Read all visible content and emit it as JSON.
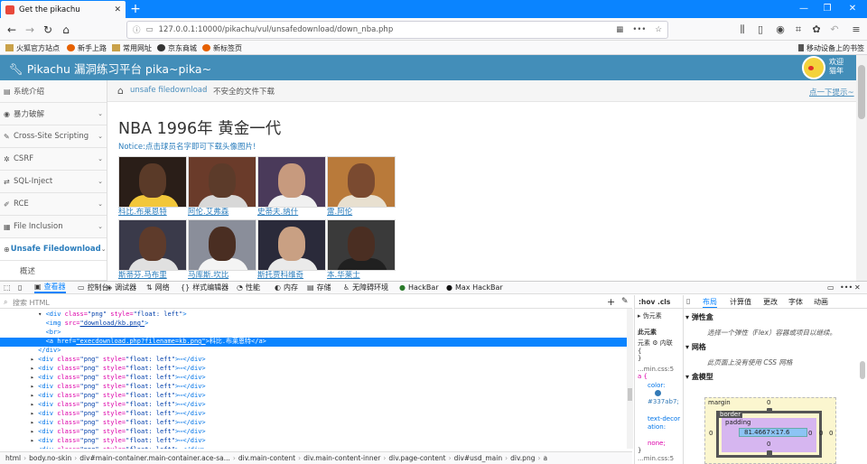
{
  "browser": {
    "tab_title": "Get the pikachu",
    "tab_close": "✕",
    "new_tab": "+",
    "url": "127.0.0.1:10000/pikachu/vul/unsafedownload/down_nba.php",
    "bookmarks": [
      "火狐官方站点",
      "新手上路",
      "常用网址",
      "京东商城",
      "新标签页"
    ],
    "mobile_bookmarks": "移动设备上的书签"
  },
  "site": {
    "title": "Pikachu 漏洞练习平台 pika~pika~",
    "welcome": [
      "欢迎",
      "猫年"
    ]
  },
  "sidebar": {
    "items": [
      {
        "icon": "▤",
        "label": "系统介绍",
        "chev": ""
      },
      {
        "icon": "◉",
        "label": "暴力破解",
        "chev": "⌄"
      },
      {
        "icon": "✎",
        "label": "Cross-Site Scripting",
        "chev": "⌄"
      },
      {
        "icon": "✲",
        "label": "CSRF",
        "chev": "⌄"
      },
      {
        "icon": "⇄",
        "label": "SQL-Inject",
        "chev": "⌄"
      },
      {
        "icon": "✐",
        "label": "RCE",
        "chev": "⌄"
      },
      {
        "icon": "▦",
        "label": "File Inclusion",
        "chev": "⌄"
      },
      {
        "icon": "⊕",
        "label": "Unsafe Filedownload",
        "chev": "⌄"
      },
      {
        "icon": "",
        "label": "概述",
        "chev": ""
      }
    ]
  },
  "breadcrumb": {
    "link": "unsafe filedownload",
    "separator": "›",
    "current": "不安全的文件下载",
    "hint": "点一下提示~"
  },
  "content": {
    "title": "NBA 1996年 黄金一代",
    "notice": "Notice:点击球员名字即可下载头像图片!",
    "players": [
      {
        "name": "科比.布莱恩特",
        "skin": "#5a3a28",
        "shirt": "#f2c73a",
        "bg": "#2a1e18"
      },
      {
        "name": "阿伦.艾弗森",
        "skin": "#5c3b2a",
        "shirt": "#d8d8d8",
        "bg": "#6a3b2a"
      },
      {
        "name": "史蒂夫.纳什",
        "skin": "#c79a7e",
        "shirt": "#f0f0f0",
        "bg": "#4a3a5a"
      },
      {
        "name": "雷.阿伦",
        "skin": "#7a4a30",
        "shirt": "#e8e0d0",
        "bg": "#b97a3a"
      },
      {
        "name": "斯蒂芬.马布里",
        "skin": "#5e3b2b",
        "shirt": "#e0e0e0",
        "bg": "#3a3a4a"
      },
      {
        "name": "马库斯.坎比",
        "skin": "#4a2e22",
        "shirt": "#f4f4f4",
        "bg": "#8a8e9a"
      },
      {
        "name": "斯托贾科维奇",
        "skin": "#c9a083",
        "shirt": "#eaeaea",
        "bg": "#2a2a3a"
      },
      {
        "name": "本.华莱士",
        "skin": "#4a2e22",
        "shirt": "#202020",
        "bg": "#3a3a3a"
      }
    ]
  },
  "devtools": {
    "tabs": [
      {
        "icon": "▣",
        "label": "查看器"
      },
      {
        "icon": "▭",
        "label": "控制台"
      },
      {
        "icon": "◈",
        "label": "调试器"
      },
      {
        "icon": "⇅",
        "label": "网络"
      },
      {
        "icon": "{}",
        "label": "样式编辑器"
      },
      {
        "icon": "◔",
        "label": "性能"
      },
      {
        "icon": "◐",
        "label": "内存"
      },
      {
        "icon": "▤",
        "label": "存储"
      },
      {
        "icon": "♿",
        "label": "无障碍环境"
      },
      {
        "icon": "●",
        "label": "HackBar"
      },
      {
        "icon": "●",
        "label": "Max HackBar"
      }
    ],
    "search_placeholder": "搜索 HTML",
    "markup_lines": [
      {
        "indent": "          ",
        "arrow": "▾ ",
        "open": "<div",
        "a1": " class=",
        "v1": "\"png\"",
        "a2": " style=",
        "v2": "\"float: left\"",
        "close": ">",
        "tail": ""
      },
      {
        "indent": "            ",
        "arrow": "",
        "open": "<img",
        "a1": " src=",
        "v1": "\"download/kb.png\"",
        "a2": "",
        "v2": "",
        "close": ">",
        "tail": ""
      },
      {
        "indent": "            ",
        "arrow": "",
        "open": "<br>",
        "a1": "",
        "v1": "",
        "a2": "",
        "v2": "",
        "close": "",
        "tail": ""
      },
      {
        "indent": "            ",
        "arrow": "",
        "open": "<a",
        "a1": " href=",
        "v1": "\"execdownload.php?filename=kb.png\"",
        "a2": "",
        "v2": "",
        "close": ">",
        "tail": "科比.布莱恩特</a>"
      },
      {
        "indent": "          ",
        "arrow": "",
        "open": "</div>",
        "a1": "",
        "v1": "",
        "a2": "",
        "v2": "",
        "close": "",
        "tail": ""
      },
      {
        "indent": "        ",
        "arrow": "▸ ",
        "open": "<div",
        "a1": " class=",
        "v1": "\"png\"",
        "a2": " style=",
        "v2": "\"float: left\"",
        "close": ">",
        "tail": "⋯</div>"
      },
      {
        "indent": "        ",
        "arrow": "▸ ",
        "open": "<div",
        "a1": " class=",
        "v1": "\"png\"",
        "a2": " style=",
        "v2": "\"float: left\"",
        "close": ">",
        "tail": "⋯</div>"
      },
      {
        "indent": "        ",
        "arrow": "▸ ",
        "open": "<div",
        "a1": " class=",
        "v1": "\"png\"",
        "a2": " style=",
        "v2": "\"float: left\"",
        "close": ">",
        "tail": "⋯</div>"
      },
      {
        "indent": "        ",
        "arrow": "▸ ",
        "open": "<div",
        "a1": " class=",
        "v1": "\"png\"",
        "a2": " style=",
        "v2": "\"float: left\"",
        "close": ">",
        "tail": "⋯</div>"
      },
      {
        "indent": "        ",
        "arrow": "▸ ",
        "open": "<div",
        "a1": " class=",
        "v1": "\"png\"",
        "a2": " style=",
        "v2": "\"float: left\"",
        "close": ">",
        "tail": "⋯</div>"
      },
      {
        "indent": "        ",
        "arrow": "▸ ",
        "open": "<div",
        "a1": " class=",
        "v1": "\"png\"",
        "a2": " style=",
        "v2": "\"float: left\"",
        "close": ">",
        "tail": "⋯</div>"
      },
      {
        "indent": "        ",
        "arrow": "▸ ",
        "open": "<div",
        "a1": " class=",
        "v1": "\"png\"",
        "a2": " style=",
        "v2": "\"float: left\"",
        "close": ">",
        "tail": "⋯</div>"
      },
      {
        "indent": "        ",
        "arrow": "▸ ",
        "open": "<div",
        "a1": " class=",
        "v1": "\"png\"",
        "a2": " style=",
        "v2": "\"float: left\"",
        "close": ">",
        "tail": "⋯</div>"
      },
      {
        "indent": "        ",
        "arrow": "▸ ",
        "open": "<div",
        "a1": " class=",
        "v1": "\"png\"",
        "a2": " style=",
        "v2": "\"float: left\"",
        "close": ">",
        "tail": "⋯</div>"
      },
      {
        "indent": "        ",
        "arrow": "▸ ",
        "open": "<div",
        "a1": " class=",
        "v1": "\"png\"",
        "a2": " style=",
        "v2": "\"float: left\"",
        "close": ">",
        "tail": "⋯</div>"
      },
      {
        "indent": "        ",
        "arrow": "▸ ",
        "open": "<div",
        "a1": " class=",
        "v1": "\"png\"",
        "a2": " style=",
        "v2": "\"float: left\"",
        "close": ">",
        "tail": "⋯</div>"
      }
    ],
    "html_crumbs": [
      "html",
      "body.no-skin",
      "div#main-container.main-container.ace-sa...",
      "div.main-content",
      "div.main-content-inner",
      "div.page-content",
      "div#usd_main",
      "div.png",
      "a"
    ],
    "rules": {
      "header": ":hov  .cls",
      "pseudo": "伪元素",
      "this_element": "此元素",
      "element_label": "元素",
      "inline_label": "内联",
      "brace_open": "{",
      "brace_close": "}",
      "file1": "...min.css:5",
      "sel": "a {",
      "color_prop": "color:",
      "color_val": "#337ab7;",
      "deco_prop": "text-decoration:",
      "deco_val": "none;",
      "file2": "...min.css:5"
    },
    "layout_tabs": [
      "布局",
      "计算值",
      "更改",
      "字体",
      "动画"
    ],
    "flex_title": "弹性盒",
    "flex_desc": "选择一个弹性（Flex）容器或项目以继续。",
    "grid_title": "网格",
    "grid_desc": "此页面上没有使用 CSS 网格",
    "box_title": "盒模型",
    "box": {
      "margin_label": "margin",
      "border_label": "border",
      "padding_label": "padding",
      "content": "81.4667×17.6",
      "zero": "0"
    },
    "accent": "#0a84ff"
  }
}
